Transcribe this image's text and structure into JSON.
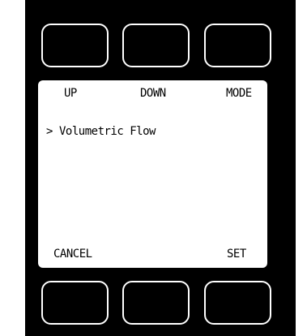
{
  "softkeys": {
    "top": [
      "UP",
      "DOWN",
      "MODE"
    ],
    "bottom_left": "CANCEL",
    "bottom_right": "SET"
  },
  "menu": {
    "cursor": ">",
    "selected_item": "Volumetric Flow"
  }
}
